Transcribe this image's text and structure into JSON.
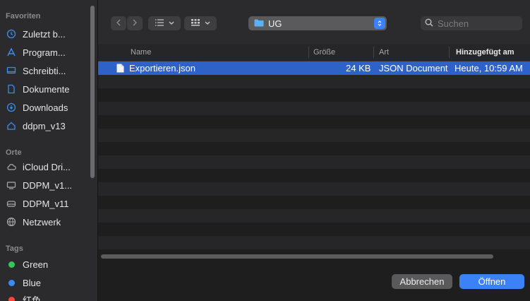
{
  "sidebar": {
    "favorites_title": "Favoriten",
    "favorites": [
      {
        "label": "Zuletzt b...",
        "icon": "clock-icon"
      },
      {
        "label": "Program...",
        "icon": "applications-icon"
      },
      {
        "label": "Schreibti...",
        "icon": "desktop-icon"
      },
      {
        "label": "Dokumente",
        "icon": "document-icon"
      },
      {
        "label": "Downloads",
        "icon": "download-icon"
      },
      {
        "label": "ddpm_v13",
        "icon": "home-icon"
      }
    ],
    "places_title": "Orte",
    "places": [
      {
        "label": "iCloud Dri...",
        "icon": "cloud-icon"
      },
      {
        "label": "DDPM_v1...",
        "icon": "display-icon"
      },
      {
        "label": "DDPM_v11",
        "icon": "drive-icon"
      },
      {
        "label": "Netzwerk",
        "icon": "network-icon"
      }
    ],
    "tags_title": "Tags",
    "tags": [
      {
        "label": "Green",
        "color": "#34c759"
      },
      {
        "label": "Blue",
        "color": "#3b8cf0"
      },
      {
        "label": "红色",
        "color": "#ff453a"
      }
    ]
  },
  "toolbar": {
    "back_icon": "chevron-left-icon",
    "forward_icon": "chevron-right-icon",
    "list_view_icon": "list-view-icon",
    "grid_view_icon": "grid-view-icon",
    "folder_name": "UG",
    "search_placeholder": "Suchen"
  },
  "table": {
    "headers": {
      "name": "Name",
      "size": "Größe",
      "kind": "Art",
      "added": "Hinzugefügt am"
    },
    "rows": [
      {
        "name": "Exportieren.json",
        "size": "24 KB",
        "kind": "JSON Document",
        "added": "Heute, 10:59 AM"
      }
    ]
  },
  "footer": {
    "cancel_label": "Abbrechen",
    "open_label": "Öffnen"
  },
  "colors": {
    "accent": "#3b82f7",
    "selection": "#2f62c9"
  }
}
